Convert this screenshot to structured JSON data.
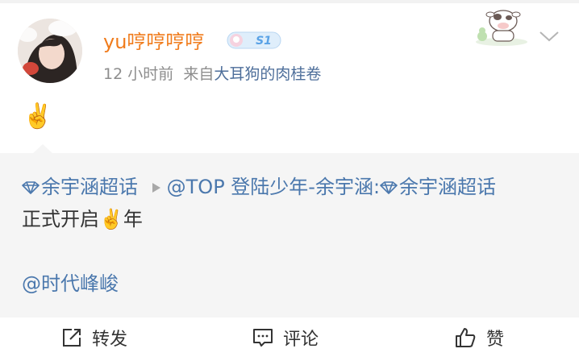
{
  "post": {
    "username": "yu哼哼哼哼",
    "vip_badge": "S1",
    "time_ago": "12 小时前",
    "source_prefix": "来自",
    "source_name": "大耳狗的肉桂卷",
    "content_emoji": "✌️"
  },
  "repost": {
    "topic_a": "余宇涵超话",
    "mention": "@TOP 登陆少年-余宇涵:",
    "topic_b": "余宇涵超话",
    "text_before_emoji": "正式开启",
    "emoji": "✌️",
    "text_after_emoji": "年",
    "mention2": "@时代峰峻"
  },
  "actions": {
    "repost_label": "转发",
    "comment_label": "评论",
    "like_label": "赞"
  },
  "colors": {
    "username": "#f07b1b",
    "link": "#4b78ad",
    "meta": "#8d8d8d",
    "repost_bg": "#f5f5f5"
  },
  "icons": [
    "diamond-topic-icon",
    "triangle-separator-icon",
    "chevron-down-icon",
    "repost-icon",
    "comment-icon",
    "like-icon"
  ]
}
